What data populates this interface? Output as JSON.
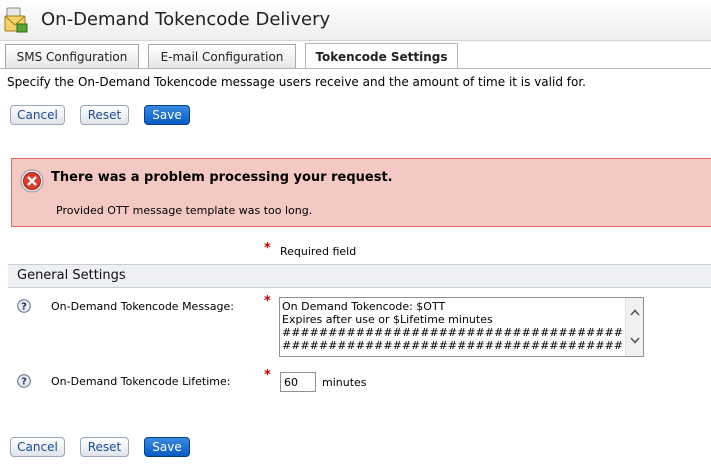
{
  "header": {
    "title": "On-Demand Tokencode Delivery",
    "icon": "envelope-icon"
  },
  "tabs": [
    {
      "label": "SMS Configuration",
      "active": false
    },
    {
      "label": "E-mail Configuration",
      "active": false
    },
    {
      "label": "Tokencode Settings",
      "active": true
    }
  ],
  "description": "Specify the On-Demand Tokencode message users receive and the amount of time it is valid for.",
  "buttons": {
    "cancel": "Cancel",
    "reset": "Reset",
    "save": "Save"
  },
  "error": {
    "title": "There was a problem processing your request.",
    "message": "Provided OTT message template was too long."
  },
  "required": {
    "star": "*",
    "label": "Required field"
  },
  "section": {
    "title": "General Settings"
  },
  "fields": {
    "message": {
      "label": "On-Demand Tokencode Message:",
      "value": "On Demand Tokencode: $OTT\nExpires after use or $Lifetime minutes\n##################################################\n##################################################"
    },
    "lifetime": {
      "label": "On-Demand Tokencode Lifetime:",
      "value": "60",
      "unit": "minutes"
    }
  },
  "colors": {
    "save_button": "#0a5cc2",
    "error_background": "#f4c9c4",
    "error_border": "#df6d66",
    "required_star": "#c00000"
  }
}
